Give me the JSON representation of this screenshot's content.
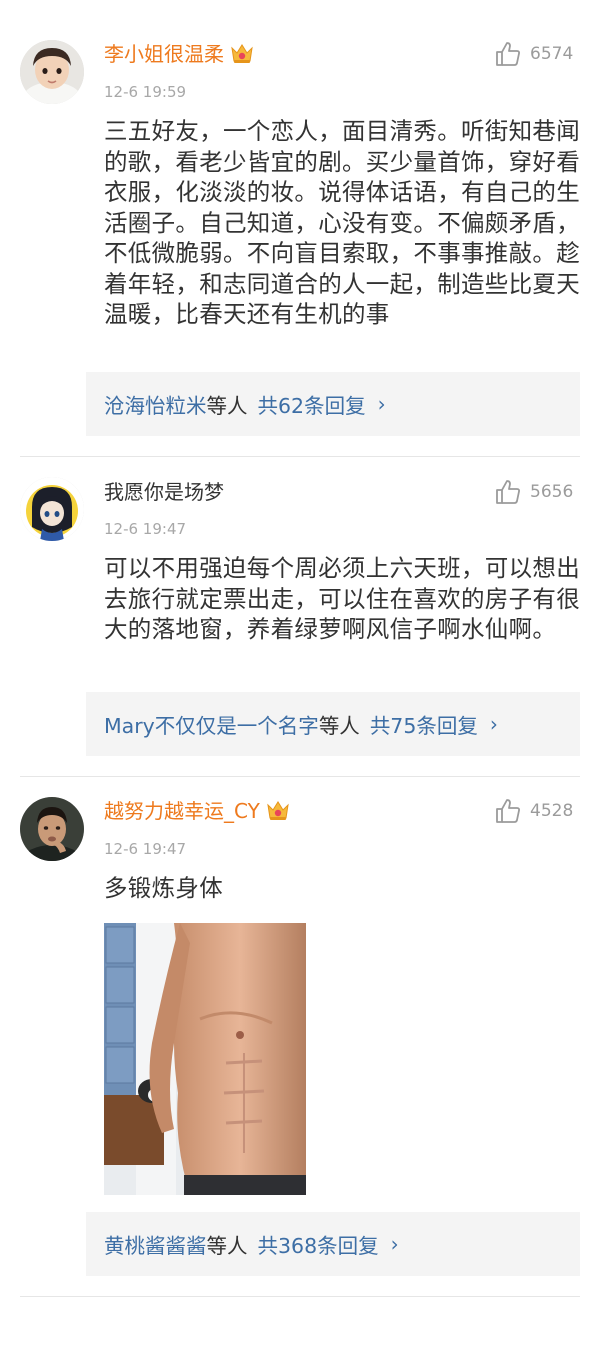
{
  "comments": [
    {
      "username": "李小姐很温柔",
      "vip": true,
      "timestamp": "12-6 19:59",
      "likes": "6574",
      "text": "三五好友，一个恋人，面目清秀。听街知巷闻的歌，看老少皆宜的剧。买少量首饰，穿好看衣服，化淡淡的妆。说得体话语，有自己的生活圈子。自己知道，心没有变。不偏颇矛盾，不低微脆弱。不向盲目索取，不事事推敲。趁着年轻，和志同道合的人一起，制造些比夏天温暖，比春天还有生机的事",
      "replies": {
        "name": "沧海怡粒米",
        "suffix": "等人",
        "count": "共62条回复",
        "chevron": "›"
      }
    },
    {
      "username": "我愿你是场梦",
      "vip": false,
      "timestamp": "12-6 19:47",
      "likes": "5656",
      "text": "可以不用强迫每个周必须上六天班，可以想出去旅行就定票出走，可以住在喜欢的房子有很大的落地窗，养着绿萝啊风信子啊水仙啊。",
      "replies": {
        "name": "Mary不仅仅是一个名字",
        "suffix": "等人",
        "count": "共75条回复",
        "chevron": "›"
      }
    },
    {
      "username": "越努力越幸运_CY",
      "vip": true,
      "timestamp": "12-6 19:47",
      "likes": "4528",
      "text": "多锻炼身体",
      "replies": {
        "name": "黄桃酱酱酱",
        "suffix": "等人",
        "count": "共368条回复",
        "chevron": "›"
      }
    }
  ],
  "colors": {
    "vip_name": "#ee7a1e",
    "link": "#3d6ea5",
    "reply_bg": "#f4f4f4",
    "meta": "#a8a8a8"
  },
  "icons": [
    "thumbs-up-icon",
    "vip-crown-icon",
    "chevron-right-icon"
  ]
}
